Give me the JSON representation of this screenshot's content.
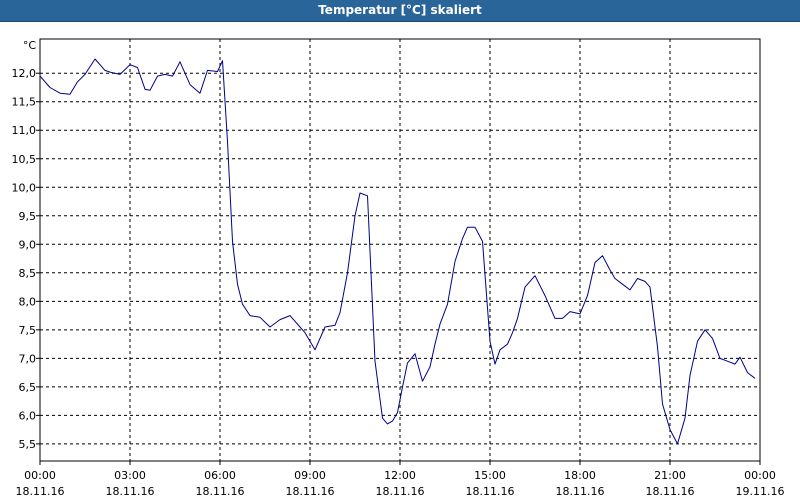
{
  "window": {
    "title": "Temperatur [°C] skaliert"
  },
  "chart_data": {
    "type": "line",
    "title": "Temperatur [°C] skaliert",
    "ylabel": "°C",
    "xlabel": "",
    "ylim": [
      5.2,
      12.6
    ],
    "yticks": [
      {
        "value": 5.5,
        "label": "5,5"
      },
      {
        "value": 6.0,
        "label": "6,0"
      },
      {
        "value": 6.5,
        "label": "6,5"
      },
      {
        "value": 7.0,
        "label": "7,0"
      },
      {
        "value": 7.5,
        "label": "7,5"
      },
      {
        "value": 8.0,
        "label": "8,0"
      },
      {
        "value": 8.5,
        "label": "8,5"
      },
      {
        "value": 9.0,
        "label": "9,0"
      },
      {
        "value": 9.5,
        "label": "9,5"
      },
      {
        "value": 10.0,
        "label": "10,0"
      },
      {
        "value": 10.5,
        "label": "10,5"
      },
      {
        "value": 11.0,
        "label": "11,0"
      },
      {
        "value": 11.5,
        "label": "11,5"
      },
      {
        "value": 12.0,
        "label": "12,0"
      }
    ],
    "xlim": [
      "18.11.16 00:00",
      "19.11.16 00:00"
    ],
    "xticks": [
      {
        "time": "00:00",
        "date": "18.11.16"
      },
      {
        "time": "03:00",
        "date": "18.11.16"
      },
      {
        "time": "06:00",
        "date": "18.11.16"
      },
      {
        "time": "09:00",
        "date": "18.11.16"
      },
      {
        "time": "12:00",
        "date": "18.11.16"
      },
      {
        "time": "15:00",
        "date": "18.11.16"
      },
      {
        "time": "18:00",
        "date": "18.11.16"
      },
      {
        "time": "21:00",
        "date": "18.11.16"
      },
      {
        "time": "00:00",
        "date": "19.11.16"
      }
    ],
    "grid": true,
    "line_color": "#00008b",
    "grid_color": "#000000",
    "series": [
      {
        "x": [
          "18.11.16 00:00",
          "18.11.16 00:20",
          "18.11.16 00:40",
          "18.11.16 01:00",
          "18.11.16 01:15",
          "18.11.16 01:30",
          "18.11.16 01:50",
          "18.11.16 02:10",
          "18.11.16 02:20",
          "18.11.16 02:40",
          "18.11.16 03:00",
          "18.11.16 03:15",
          "18.11.16 03:30",
          "18.11.16 03:40",
          "18.11.16 03:55",
          "18.11.16 04:10",
          "18.11.16 04:25",
          "18.11.16 04:40",
          "18.11.16 05:00",
          "18.11.16 05:20",
          "18.11.16 05:35",
          "18.11.16 05:55",
          "18.11.16 06:05",
          "18.11.16 06:15",
          "18.11.16 06:25",
          "18.11.16 06:35",
          "18.11.16 06:45",
          "18.11.16 07:00",
          "18.11.16 07:20",
          "18.11.16 07:40",
          "18.11.16 08:00",
          "18.11.16 08:20",
          "18.11.16 08:40",
          "18.11.16 08:50",
          "18.11.16 09:10",
          "18.11.16 09:30",
          "18.11.16 09:50",
          "18.11.16 10:00",
          "18.11.16 10:15",
          "18.11.16 10:30",
          "18.11.16 10:40",
          "18.11.16 10:55",
          "18.11.16 11:10",
          "18.11.16 11:25",
          "18.11.16 11:35",
          "18.11.16 11:45",
          "18.11.16 11:55",
          "18.11.16 12:05",
          "18.11.16 12:15",
          "18.11.16 12:30",
          "18.11.16 12:45",
          "18.11.16 13:00",
          "18.11.16 13:10",
          "18.11.16 13:20",
          "18.11.16 13:35",
          "18.11.16 13:50",
          "18.11.16 14:05",
          "18.11.16 14:15",
          "18.11.16 14:30",
          "18.11.16 14:45",
          "18.11.16 15:00",
          "18.11.16 15:10",
          "18.11.16 15:20",
          "18.11.16 15:35",
          "18.11.16 15:45",
          "18.11.16 15:55",
          "18.11.16 16:10",
          "18.11.16 16:30",
          "18.11.16 16:50",
          "18.11.16 17:10",
          "18.11.16 17:25",
          "18.11.16 17:40",
          "18.11.16 18:00",
          "18.11.16 18:15",
          "18.11.16 18:30",
          "18.11.16 18:45",
          "18.11.16 19:00",
          "18.11.16 19:10",
          "18.11.16 19:25",
          "18.11.16 19:40",
          "18.11.16 19:55",
          "18.11.16 20:10",
          "18.11.16 20:20",
          "18.11.16 20:35",
          "18.11.16 20:45",
          "18.11.16 21:00",
          "18.11.16 21:15",
          "18.11.16 21:30",
          "18.11.16 21:40",
          "18.11.16 21:55",
          "18.11.16 22:10",
          "18.11.16 22:25",
          "18.11.16 22:40",
          "18.11.16 22:55",
          "18.11.16 23:10",
          "18.11.16 23:20",
          "18.11.16 23:35",
          "18.11.16 23:50"
        ],
        "y": [
          11.95,
          11.75,
          11.65,
          11.63,
          11.85,
          11.98,
          12.25,
          12.05,
          12.02,
          11.98,
          12.15,
          12.1,
          11.72,
          11.7,
          11.95,
          11.98,
          11.95,
          12.2,
          11.8,
          11.65,
          12.05,
          12.03,
          12.22,
          10.8,
          9.05,
          8.3,
          7.95,
          7.75,
          7.72,
          7.55,
          7.68,
          7.75,
          7.55,
          7.45,
          7.15,
          7.55,
          7.58,
          7.8,
          8.5,
          9.5,
          9.9,
          9.85,
          6.95,
          5.95,
          5.85,
          5.9,
          6.05,
          6.5,
          6.92,
          7.08,
          6.6,
          6.85,
          7.25,
          7.6,
          7.95,
          8.7,
          9.1,
          9.3,
          9.3,
          9.05,
          7.3,
          6.9,
          7.15,
          7.25,
          7.45,
          7.7,
          8.25,
          8.45,
          8.1,
          7.7,
          7.7,
          7.82,
          7.78,
          8.1,
          8.68,
          8.8,
          8.55,
          8.4,
          8.3,
          8.2,
          8.4,
          8.35,
          8.25,
          7.2,
          6.2,
          5.75,
          5.5,
          5.95,
          6.7,
          7.3,
          7.5,
          7.35,
          7.0,
          6.95,
          6.9,
          7.02,
          6.75,
          6.65
        ]
      }
    ]
  }
}
